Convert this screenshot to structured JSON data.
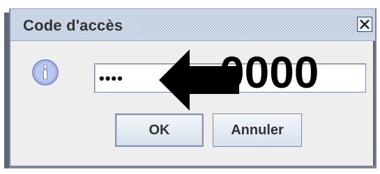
{
  "dialog": {
    "title": "Code d'accès",
    "close_icon": "close-icon",
    "info_icon": "info-icon"
  },
  "password": {
    "masked_value": "••••",
    "annotation_arrow": "arrow-left-icon",
    "annotation_code": "0000"
  },
  "buttons": {
    "ok_label": "OK",
    "cancel_label": "Annuler"
  },
  "colors": {
    "titlebar": "#c9d4e4",
    "dialog_bg": "#eeeeee",
    "border": "#7b8596",
    "info_icon_fill": "#a9b5e6"
  }
}
